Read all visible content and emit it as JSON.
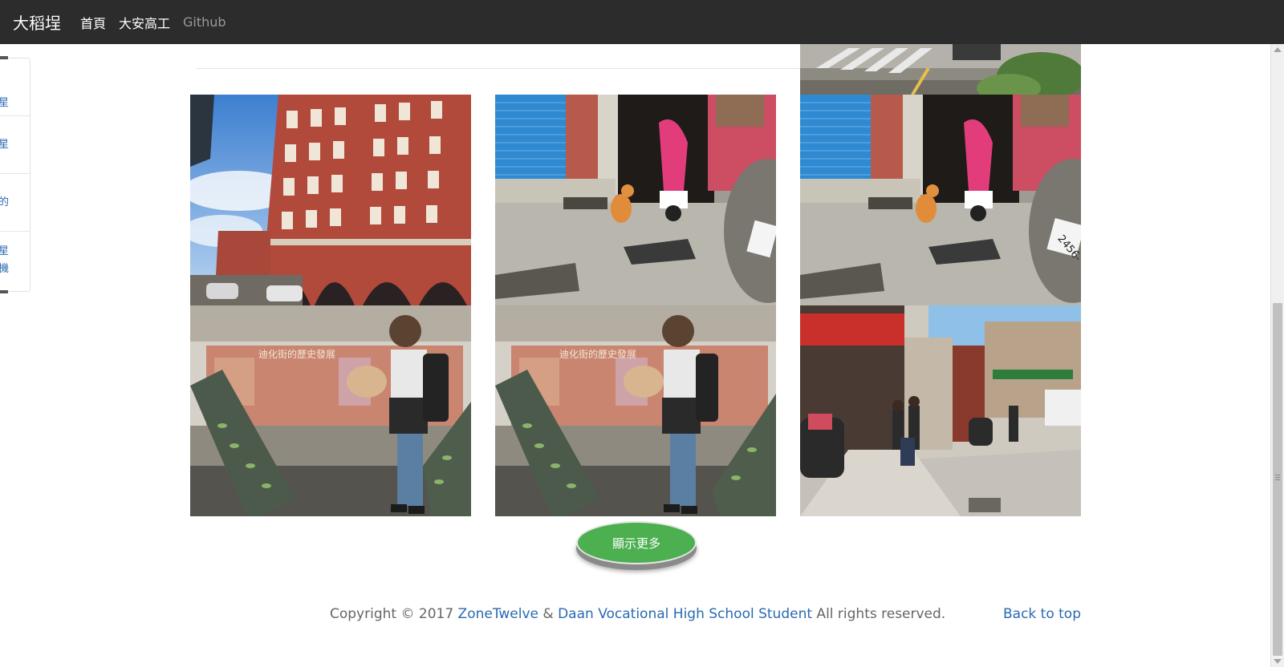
{
  "navbar": {
    "brand": "大稻埕",
    "links": [
      {
        "label": "首頁"
      },
      {
        "label": "大安高工"
      },
      {
        "label": "Github"
      }
    ]
  },
  "side_nav": {
    "items": [
      {
        "label": "星"
      },
      {
        "label": "星"
      },
      {
        "label": "的"
      },
      {
        "label": "星"
      },
      {
        "label": "機"
      }
    ]
  },
  "gallery": {
    "photos": [
      {
        "description": "partial street photo with crosswalk"
      },
      {
        "description": "red brick historic building"
      },
      {
        "description": "orange cat beside scooter in doorway"
      },
      {
        "description": "orange cat beside scooter in doorway"
      },
      {
        "description": "student reading Dihua Street history board"
      },
      {
        "description": "student reading Dihua Street history board"
      },
      {
        "description": "busy Dihua Street scene with pedestrians"
      }
    ],
    "sign_text": "迪化街的歷史發展",
    "license_plate": "2456-"
  },
  "show_more_label": "顯示更多",
  "footer": {
    "prefix": "Copyright © 2017 ",
    "author": "ZoneTwelve",
    "amp": " & ",
    "school": "Daan Vocational High School Student",
    "suffix": " All rights reserved.",
    "back_to_top": "Back to top"
  },
  "colors": {
    "navbar_bg": "#2c2c2c",
    "link_blue": "#2a6ab2",
    "button_green": "#4caf50"
  }
}
